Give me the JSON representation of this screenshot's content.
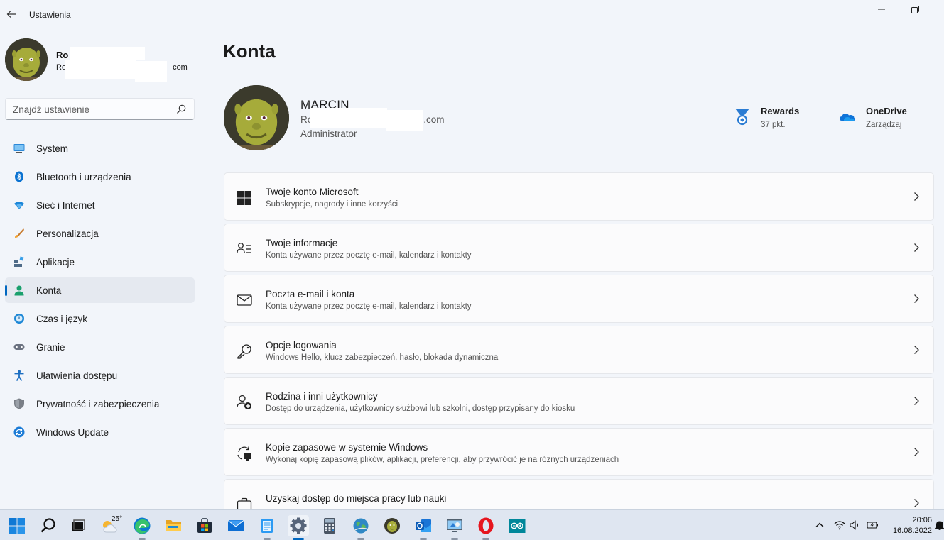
{
  "window": {
    "title": "Ustawienia"
  },
  "sidebar": {
    "user_name": "Ro",
    "user_email_prefix": "Ro",
    "user_email_suffix": "com",
    "search": {
      "placeholder": "Znajdź ustawienie",
      "value": ""
    },
    "items": [
      {
        "label": "System",
        "icon": "monitor-icon"
      },
      {
        "label": "Bluetooth i urządzenia",
        "icon": "bluetooth-icon"
      },
      {
        "label": "Sieć i Internet",
        "icon": "wifi-icon"
      },
      {
        "label": "Personalizacja",
        "icon": "brush-icon"
      },
      {
        "label": "Aplikacje",
        "icon": "apps-icon"
      },
      {
        "label": "Konta",
        "icon": "person-icon",
        "active": true
      },
      {
        "label": "Czas i język",
        "icon": "globe-clock-icon"
      },
      {
        "label": "Granie",
        "icon": "gamepad-icon"
      },
      {
        "label": "Ułatwienia dostępu",
        "icon": "accessibility-icon"
      },
      {
        "label": "Prywatność i zabezpieczenia",
        "icon": "shield-icon"
      },
      {
        "label": "Windows Update",
        "icon": "sync-icon"
      }
    ]
  },
  "main": {
    "title": "Konta",
    "profile": {
      "name": "MARCIN",
      "email_prefix": "Ro",
      "email_suffix": ".com",
      "role": "Administrator"
    },
    "rewards": {
      "title": "Rewards",
      "subtitle": "37 pkt."
    },
    "onedrive": {
      "title": "OneDrive",
      "subtitle": "Zarządzaj"
    },
    "cards": [
      {
        "title": "Twoje konto Microsoft",
        "subtitle": "Subskrypcje, nagrody i inne korzyści",
        "icon": "windows-logo-icon"
      },
      {
        "title": "Twoje informacje",
        "subtitle": "Konta używane przez pocztę e-mail, kalendarz i kontakty",
        "icon": "person-info-icon"
      },
      {
        "title": "Poczta e-mail i konta",
        "subtitle": "Konta używane przez pocztę e-mail, kalendarz i kontakty",
        "icon": "mail-icon"
      },
      {
        "title": "Opcje logowania",
        "subtitle": "Windows Hello, klucz zabezpieczeń, hasło, blokada dynamiczna",
        "icon": "key-icon"
      },
      {
        "title": "Rodzina i inni użytkownicy",
        "subtitle": "Dostęp do urządzenia, użytkownicy służbowi lub szkolni, dostęp przypisany do kiosku",
        "icon": "person-add-icon"
      },
      {
        "title": "Kopie zapasowe w systemie Windows",
        "subtitle": "Wykonaj kopię zapasową plików, aplikacji, preferencji, aby przywrócić je na różnych urządzeniach",
        "icon": "backup-icon"
      },
      {
        "title": "Uzyskaj dostęp do miejsca pracy lub nauki",
        "subtitle": "",
        "icon": "briefcase-icon"
      }
    ]
  },
  "taskbar": {
    "weather_temp": "25°",
    "time": "20:06",
    "date": "16.08.2022",
    "apps": [
      "start",
      "search",
      "task-view",
      "weather",
      "edge",
      "file-explorer",
      "store",
      "mail",
      "notepad",
      "settings",
      "calculator",
      "globe-app",
      "shrek-app",
      "outlook",
      "remote-desktop",
      "opera",
      "arduino"
    ]
  },
  "colors": {
    "accent": "#0067c0",
    "background": "#f2f5fa",
    "card": "#fbfbfc"
  }
}
